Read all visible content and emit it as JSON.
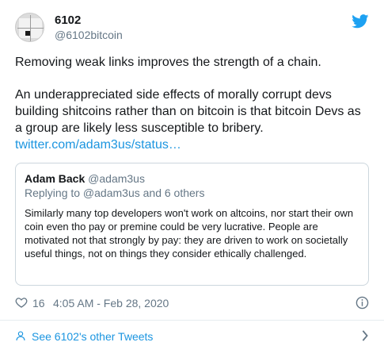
{
  "tweet": {
    "display_name": "6102",
    "handle": "@6102bitcoin",
    "paragraph1": "Removing weak links improves the strength of a chain.",
    "paragraph2": "An underappreciated side effects of morally corrupt devs building shitcoins rather than on bitcoin is that bitcoin Devs as a group are likely less susceptible to bribery.",
    "link_text": "twitter.com/adam3us/status…"
  },
  "quote": {
    "name": "Adam Back",
    "handle": "@adam3us",
    "reply_line": "Replying to @adam3us and 6 others",
    "text": "Similarly many top developers won't work on altcoins, nor start their own coin even tho pay or premine could be very lucrative. People are motivated not that strongly by pay: they are driven to work on societally useful things, not on things they consider ethically challenged."
  },
  "meta": {
    "likes": "16",
    "timestamp": "4:05 AM - Feb 28, 2020"
  },
  "footer": {
    "link_text": "See 6102's other Tweets"
  },
  "icons": {
    "bird": "twitter-bird-icon",
    "heart": "heart-icon",
    "info": "info-icon",
    "person": "person-icon",
    "chevron": "chevron-right-icon"
  },
  "colors": {
    "accent": "#1da1f2",
    "link": "#1b95e0",
    "muted": "#657786",
    "border": "#ccd6dd"
  }
}
